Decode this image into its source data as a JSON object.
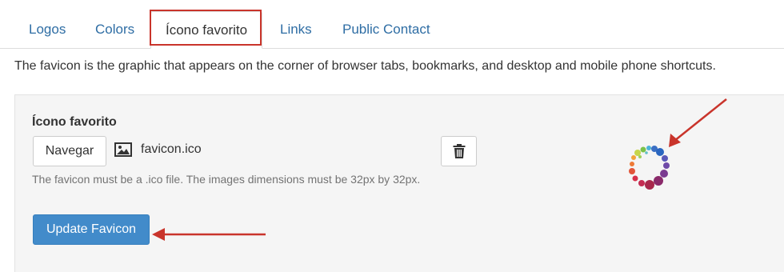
{
  "tabs": [
    {
      "label": "Logos"
    },
    {
      "label": "Colors"
    },
    {
      "label": "Ícono favorito",
      "active": true
    },
    {
      "label": "Links"
    },
    {
      "label": "Public Contact"
    }
  ],
  "description": "The favicon is the graphic that appears on the corner of browser tabs, bookmarks, and desktop and mobile phone shortcuts.",
  "favicon_field": {
    "label": "Ícono favorito",
    "browse_label": "Navegar",
    "file_name": "favicon.ico",
    "help_text": "The favicon must be a .ico file. The images dimensions must be 32px by 32px.",
    "delete_icon": "trash-icon",
    "file_icon": "image-icon"
  },
  "update_button_label": "Update Favicon",
  "colors": {
    "link": "#2e6da4",
    "primary_button": "#428bca",
    "annotation": "#c9342b",
    "panel_bg": "#f5f5f5"
  }
}
